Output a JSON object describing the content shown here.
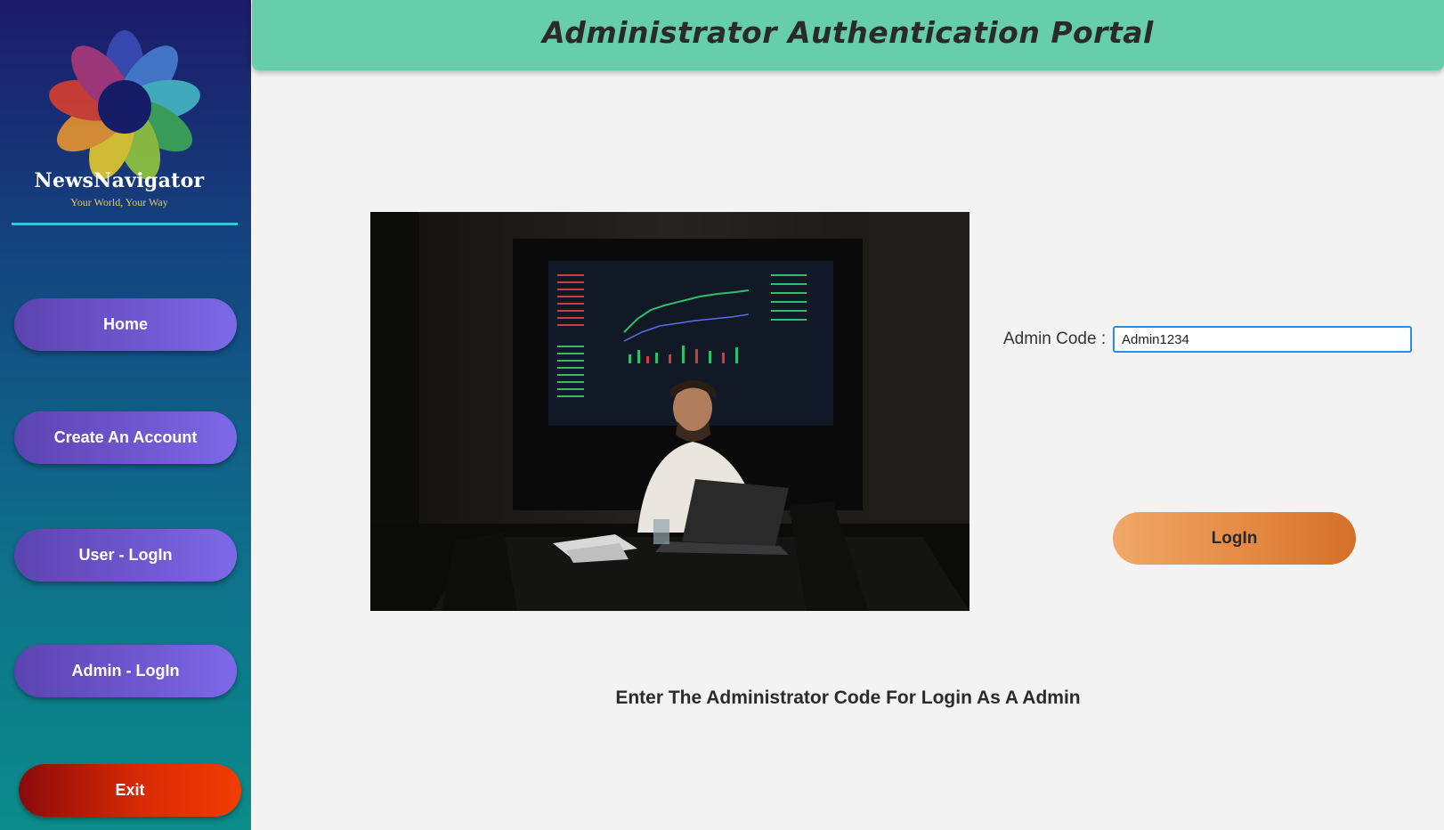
{
  "brand": {
    "name": "NewsNavigator",
    "tagline": "Your World, Your Way"
  },
  "sidebar": {
    "items": [
      {
        "label": "Home"
      },
      {
        "label": "Create An Account"
      },
      {
        "label": "User - LogIn"
      },
      {
        "label": "Admin - LogIn"
      }
    ],
    "exit_label": "Exit"
  },
  "header": {
    "title": "Administrator Authentication Portal"
  },
  "form": {
    "code_label": "Admin Code :",
    "code_value": "Admin1234",
    "login_label": "LogIn",
    "hint": "Enter The Administrator Code For Login As A Admin"
  },
  "photo": {
    "description_icon": "office-trading-photo"
  },
  "colors": {
    "header_bg": "#66ceaa",
    "nav_button": "#7d68e8",
    "exit_button": "#e83205",
    "login_button": "#e48a43",
    "input_border": "#2a8fd8"
  }
}
